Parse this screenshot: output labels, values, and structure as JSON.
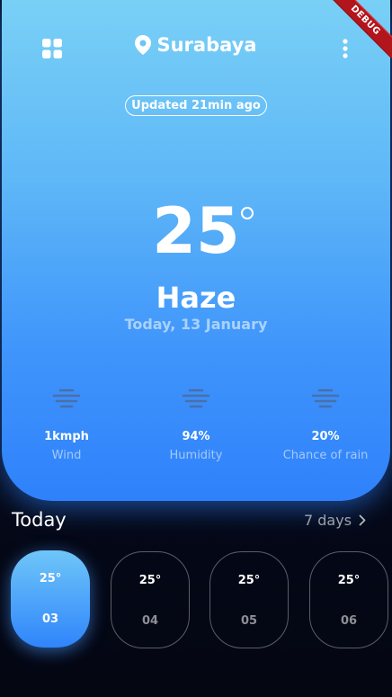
{
  "header": {
    "city": "Surabaya",
    "menu_icon": "grid-icon",
    "location_icon": "location-pin-icon",
    "more_icon": "more-vertical-icon"
  },
  "status": {
    "updated": "Updated 21min ago"
  },
  "current": {
    "temperature": "25",
    "condition": "Haze",
    "date": "Today, 13 January"
  },
  "stats": [
    {
      "icon": "haze-icon",
      "value": "1kmph",
      "label": "Wind"
    },
    {
      "icon": "haze-icon",
      "value": "94%",
      "label": "Humidity"
    },
    {
      "icon": "haze-icon",
      "value": "20%",
      "label": "Chance of rain"
    }
  ],
  "forecast": {
    "title": "Today",
    "link": "7 days",
    "days": [
      {
        "temp": "25°",
        "day": "03",
        "active": true
      },
      {
        "temp": "25°",
        "day": "04",
        "active": false
      },
      {
        "temp": "25°",
        "day": "05",
        "active": false
      },
      {
        "temp": "25°",
        "day": "06",
        "active": false
      }
    ]
  },
  "debug_banner": "DEBUG",
  "colors": {
    "accent": "#2f81fb",
    "sky_top": "#79d0f6",
    "background": "#040612",
    "debug": "#b3151c"
  }
}
